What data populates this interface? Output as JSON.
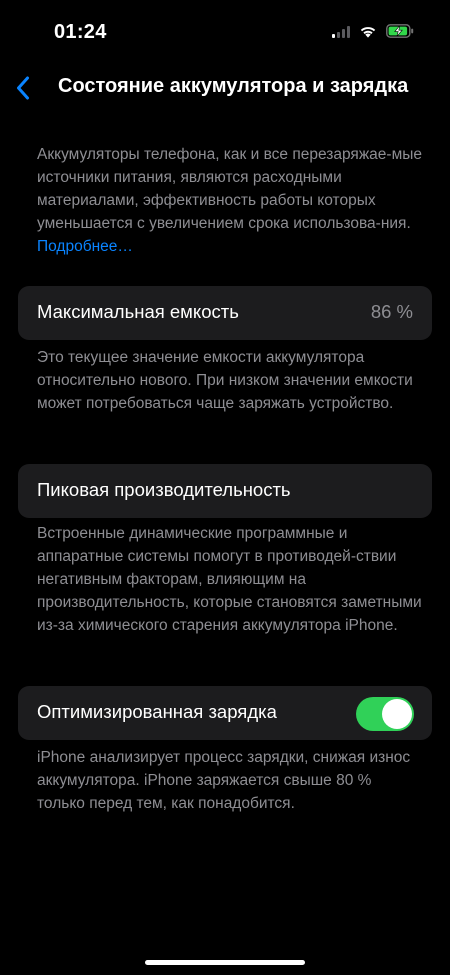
{
  "status_bar": {
    "time": "01:24",
    "signal_bars_active": 1,
    "signal_bars_total": 4,
    "battery_charging": true
  },
  "nav": {
    "back_icon": "chevron-left-icon",
    "title": "Состояние аккумулятора и зарядка"
  },
  "intro": {
    "text": "Аккумуляторы телефона, как и все перезаряжае-мые источники питания, являются расходными материалами, эффективность работы которых уменьшается с увеличением срока использова-ния.",
    "link": "Подробнее…"
  },
  "maximum_capacity": {
    "label": "Максимальная емкость",
    "value": "86 %",
    "footnote": "Это текущее значение емкости аккумулятора относительно нового. При низком значении емкости может потребоваться чаще заряжать устройство."
  },
  "peak_performance": {
    "label": "Пиковая производительность",
    "footnote": "Встроенные динамические программные и аппаратные системы помогут в противодей-ствии негативным факторам, влияющим на производительность, которые становятся заметными из-за химического старения аккумулятора iPhone."
  },
  "optimized_charging": {
    "label": "Оптимизированная зарядка",
    "enabled": true,
    "footnote": "iPhone анализирует процесс зарядки, снижая износ аккумулятора. iPhone заряжается свыше 80 % только перед тем, как понадобится."
  },
  "colors": {
    "background": "#000000",
    "card": "#1c1c1e",
    "secondary_text": "#8e8e93",
    "link": "#0a84ff",
    "toggle_on": "#30d158",
    "battery_charging": "#32d74b"
  }
}
